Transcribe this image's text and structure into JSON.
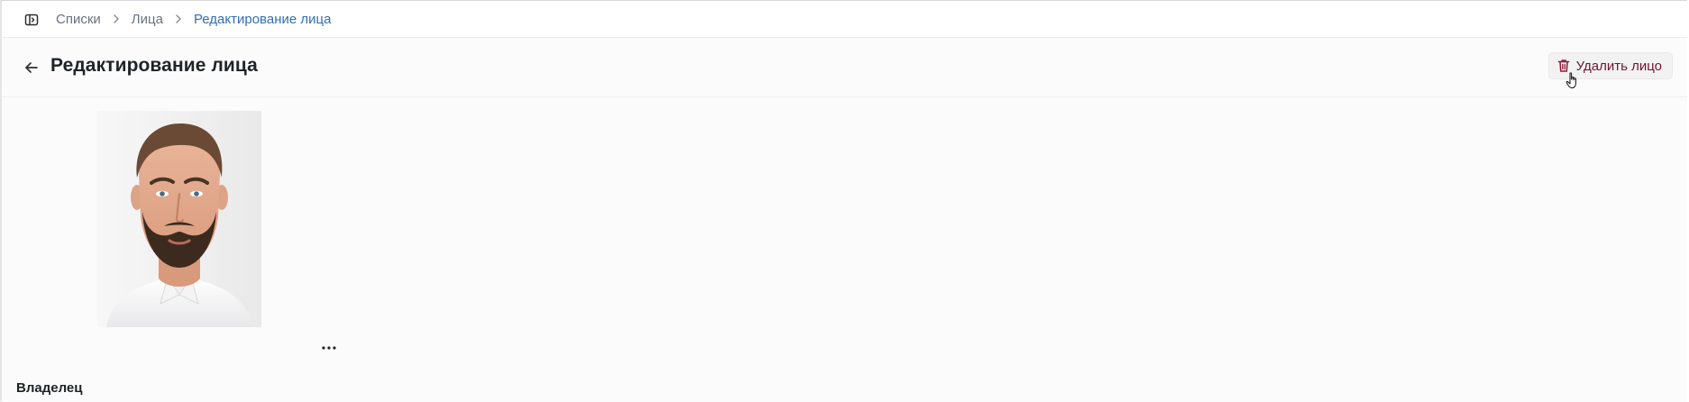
{
  "breadcrumb": {
    "items": [
      {
        "label": "Списки"
      },
      {
        "label": "Лица"
      },
      {
        "label": "Редактирование лица"
      }
    ]
  },
  "header": {
    "title": "Редактирование лица",
    "delete_label": "Удалить лицо"
  },
  "icons": {
    "sidebar_toggle": "sidebar-toggle-icon",
    "back": "arrow-left-icon",
    "chevron": "chevron-right-icon",
    "delete": "trash-icon",
    "more": "more-horizontal-icon"
  },
  "content": {
    "photo": "face-photo",
    "more_label": "...",
    "owner_label": "Владелец"
  },
  "colors": {
    "accent": "#2f6fb5",
    "danger_text": "#6e1530",
    "text": "#1f2329",
    "muted": "#6b7280"
  }
}
